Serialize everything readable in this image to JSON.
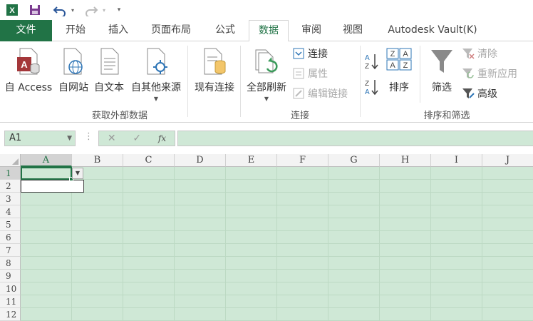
{
  "tabs": [
    {
      "label": "文件"
    },
    {
      "label": "开始"
    },
    {
      "label": "插入"
    },
    {
      "label": "页面布局"
    },
    {
      "label": "公式"
    },
    {
      "label": "数据"
    },
    {
      "label": "审阅"
    },
    {
      "label": "视图"
    },
    {
      "label": "Autodesk Vault(K)"
    }
  ],
  "active_tab": "数据",
  "ribbon": {
    "external": {
      "group_label": "获取外部数据",
      "from_access": "自 Access",
      "from_web": "自网站",
      "from_text": "自文本",
      "from_other": "自其他来源",
      "existing_conn": "现有连接"
    },
    "connections": {
      "group_label": "连接",
      "refresh_all": "全部刷新",
      "connections": "连接",
      "properties": "属性",
      "edit_links": "编辑链接"
    },
    "sort_filter": {
      "group_label": "排序和筛选",
      "sort_az_icon": "A↓Z",
      "sort_za_icon": "Z↓A",
      "sort": "排序",
      "filter": "筛选",
      "clear": "清除",
      "reapply": "重新应用",
      "advanced": "高级"
    }
  },
  "formula_bar": {
    "name_box": "A1",
    "cancel": "✕",
    "enter": "✓",
    "fx": "fx",
    "formula": ""
  },
  "sheet": {
    "columns": [
      "A",
      "B",
      "C",
      "D",
      "E",
      "F",
      "G",
      "H",
      "I",
      "J"
    ],
    "rows": [
      "1",
      "2",
      "3",
      "4",
      "5",
      "6",
      "7",
      "8",
      "9",
      "10",
      "11",
      "12"
    ],
    "selected_cell": "A1"
  },
  "colors": {
    "accent": "#217346",
    "grid_fill": "#cfe8d6"
  }
}
